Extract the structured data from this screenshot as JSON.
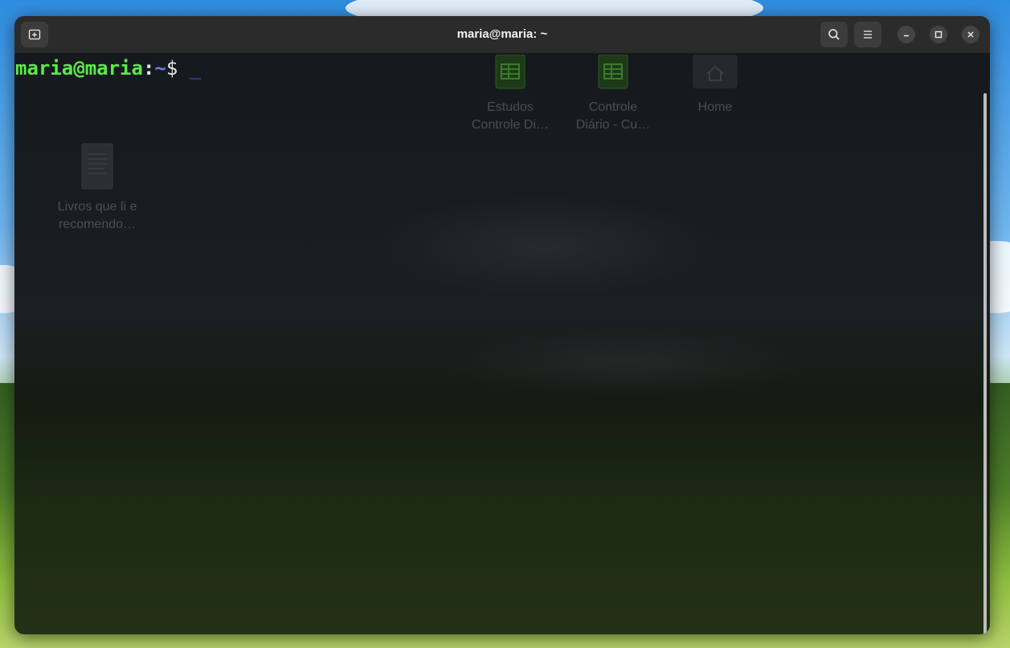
{
  "window": {
    "title": "maria@maria: ~"
  },
  "toolbar": {
    "new_tab_icon": "new-tab-icon",
    "search_icon": "search-icon",
    "menu_icon": "hamburger-menu-icon",
    "minimize_icon": "minimize-icon",
    "maximize_icon": "maximize-icon",
    "close_icon": "close-icon"
  },
  "terminal": {
    "user_host": "maria@maria",
    "colon": ":",
    "path": "~",
    "dollar": "$ ",
    "cursor": "_",
    "colors": {
      "user_host": "#5ee84a",
      "path": "#6a7cf2",
      "dollar": "#e8e8e8",
      "cursor": "#3f57e8"
    }
  },
  "desktop": {
    "icons": [
      {
        "line1": "Estudos",
        "line2": "Controle Di…",
        "icon": "spreadsheet-icon"
      },
      {
        "line1": "Controle",
        "line2": "Diário - Cu…",
        "icon": "spreadsheet-icon"
      },
      {
        "line1": "Home",
        "line2": "",
        "icon": "home-folder-icon"
      },
      {
        "line1": "Livros que li e",
        "line2": "recomendo…",
        "icon": "document-icon"
      }
    ]
  }
}
